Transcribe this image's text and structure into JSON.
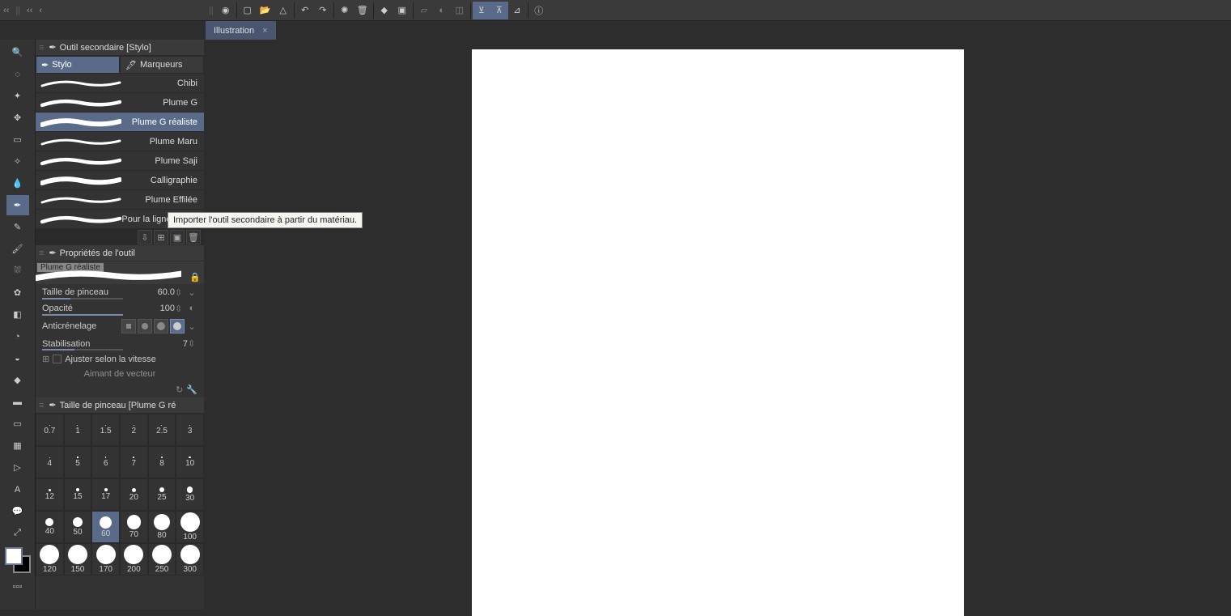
{
  "topbar": {
    "collapse_chev": "‹‹",
    "collapse_single": "‹"
  },
  "document_tabs": [
    {
      "label": "Illustration",
      "close": "×"
    }
  ],
  "subtool_panel": {
    "title": "Outil secondaire [Stylo]",
    "tabs": [
      {
        "label": "Stylo",
        "active": true
      },
      {
        "label": "Marqueurs",
        "active": false
      }
    ],
    "brushes": [
      {
        "label": "Chibi"
      },
      {
        "label": "Plume G"
      },
      {
        "label": "Plume G réaliste",
        "selected": true
      },
      {
        "label": "Plume Maru"
      },
      {
        "label": "Plume Saji"
      },
      {
        "label": "Calligraphie"
      },
      {
        "label": "Plume Effilée"
      },
      {
        "label": "Pour la ligne d'effet"
      }
    ]
  },
  "tooltip": "Importer l'outil secondaire à partir du matériau.",
  "properties_panel": {
    "title": "Propriétés de l'outil",
    "brush_name": "Plume G réaliste",
    "rows": {
      "size_label": "Taille de pinceau",
      "size_value": "60.0",
      "opacity_label": "Opacité",
      "opacity_value": "100",
      "aa_label": "Anticrénelage",
      "stab_label": "Stabilisation",
      "stab_value": "7",
      "speed_label": "Ajuster selon la vitesse",
      "magnet_label": "Aimant de vecteur"
    }
  },
  "brushsize_panel": {
    "title": "Taille de pinceau [Plume G ré",
    "sizes": [
      0.7,
      1,
      1.5,
      2,
      2.5,
      3,
      4,
      5,
      6,
      7,
      8,
      10,
      12,
      15,
      17,
      20,
      25,
      30,
      40,
      50,
      60,
      70,
      80,
      100,
      120,
      150,
      170,
      200,
      250,
      300
    ],
    "selected": 60
  }
}
